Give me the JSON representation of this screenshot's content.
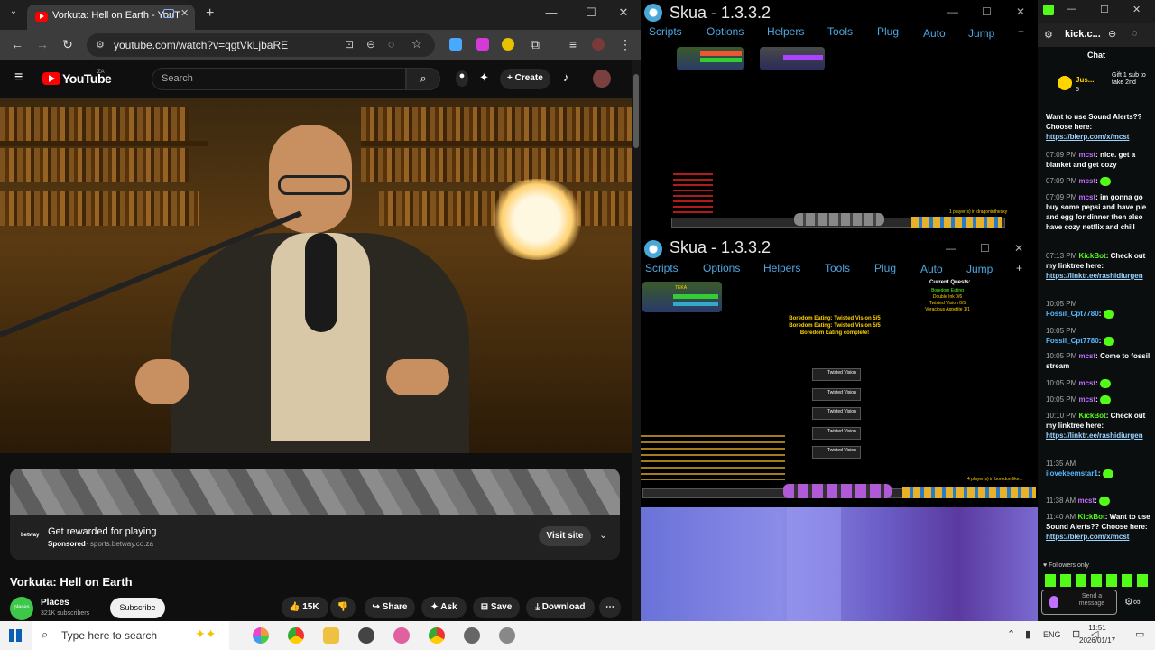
{
  "chrome": {
    "tab_title": "Vorkuta: Hell on Earth - YouT",
    "new_tab": "+",
    "url": "youtube.com/watch?v=qgtVkLjbaRE",
    "minimize": "—",
    "maximize": "☐",
    "close": "✕"
  },
  "youtube": {
    "logo_text": "YouTube",
    "region": "ZA",
    "search_placeholder": "Search",
    "create_label": "Create",
    "ad": {
      "title": "Get rewarded for playing",
      "sponsored": "Sponsored",
      "domain": "sports.betway.co.za",
      "advertiser_logo": "betway",
      "visit_label": "Visit site"
    },
    "video_title": "Vorkuta: Hell on Earth",
    "channel": {
      "name": "Places",
      "subscribers": "321K subscribers",
      "avatar_text": "places",
      "subscribe_label": "Subscribe"
    },
    "actions": {
      "likes": "15K",
      "share": "Share",
      "ask": "Ask",
      "save": "Save",
      "download": "Download"
    }
  },
  "skua_windows": [
    {
      "title": "Skua - 1.3.3.2",
      "menu": [
        "Scripts",
        "Options",
        "Helpers",
        "Tools",
        "Plug",
        "Auto",
        "Jump",
        "+"
      ],
      "status_text": "1 player(s) in dragoninthesky"
    },
    {
      "title": "Skua - 1.3.3.2",
      "menu": [
        "Scripts",
        "Options",
        "Helpers",
        "Tools",
        "Plug",
        "Auto",
        "Jump",
        "+"
      ],
      "player_name": "TEKA",
      "quests_header": "Current Quests:",
      "quests": [
        "Boredom Eating",
        "Double Ink 0/6",
        "Twisted Vision 0/5",
        "Voracious Appetite 1/1"
      ],
      "center_messages": [
        "Boredom Eating: Twisted Vision 5/5",
        "Boredom Eating: Twisted Vision 5/5",
        "Boredom Eating complete!"
      ],
      "drops": [
        "Twisted Vision",
        "Twisted Vision",
        "Twisted Vision",
        "Twisted Vision",
        "Twisted Vision"
      ],
      "drop_sub": "Quest Item",
      "status_text": "4 player(s) in boredomlike..."
    }
  ],
  "kick": {
    "tab_text": "kick.c...",
    "chat_header": "Chat",
    "pinned": {
      "user": "Jus...",
      "count": "5",
      "text": "Gift 1 sub to take 2nd"
    },
    "messages": [
      {
        "time": "",
        "user": "",
        "text": "Want to use Sound Alerts?? Choose here:",
        "link": "https://blerp.com/x/mcst"
      },
      {
        "time": "07:09 PM",
        "user": "mcst",
        "text": "nice. get a blanket and get cozy",
        "link": ""
      },
      {
        "time": "07:09 PM",
        "user": "mcst",
        "text": "",
        "link": ""
      },
      {
        "time": "07:09 PM",
        "user": "mcst",
        "text": "im gonna go buy some pepsi and have pie and egg for dinner then also have cozy netflix and chill",
        "link": ""
      },
      {
        "time": "07:13 PM",
        "user": "KickBot",
        "text": "Check out my linktree here:",
        "link": "https://linktr.ee/rashidiurgen"
      },
      {
        "time": "10:05 PM",
        "user": "Fossil_Cpt7780",
        "text": "",
        "link": ""
      },
      {
        "time": "10:05 PM",
        "user": "Fossil_Cpt7780",
        "text": "",
        "link": ""
      },
      {
        "time": "10:05 PM",
        "user": "mcst",
        "text": "Come to fossil stream",
        "link": ""
      },
      {
        "time": "10:05 PM",
        "user": "mcst",
        "text": "",
        "link": ""
      },
      {
        "time": "10:05 PM",
        "user": "mcst",
        "text": "",
        "link": ""
      },
      {
        "time": "10:10 PM",
        "user": "KickBot",
        "text": "Check out my linktree here:",
        "link": "https://linktr.ee/rashidiurgen"
      },
      {
        "time": "11:35 AM",
        "user": "ilovekeemstar1",
        "text": "",
        "link": ""
      },
      {
        "time": "11:38 AM",
        "user": "mcst",
        "text": "",
        "link": ""
      },
      {
        "time": "11:40 AM",
        "user": "KickBot",
        "text": "Want to use Sound Alerts?? Choose here:",
        "link": "https://blerp.com/x/mcst"
      }
    ],
    "followers_only": "Followers only",
    "send_placeholder": "Send a message"
  },
  "taskbar": {
    "search_placeholder": "Type here to search",
    "language": "ENG",
    "time": "11:51",
    "date": "2026/01/17"
  }
}
